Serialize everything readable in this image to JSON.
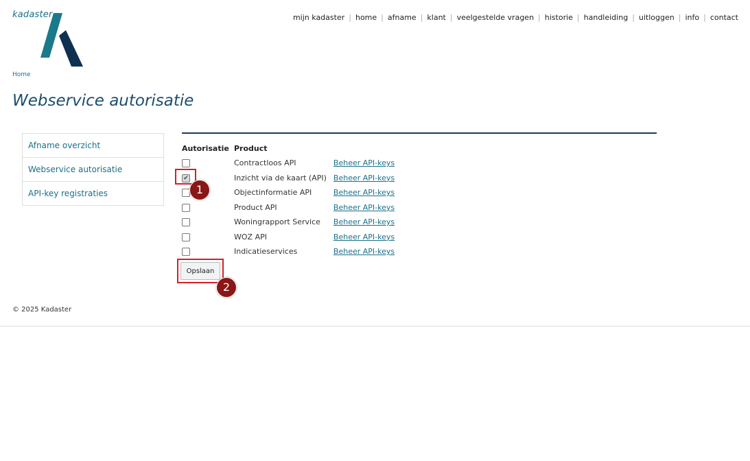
{
  "brand": {
    "logo_text": "kadaster",
    "colors": {
      "teal": "#1a7a8c",
      "navy": "#0f3050",
      "link": "#1a6f8a",
      "highlight": "#d32027",
      "badge": "#8a1616"
    }
  },
  "topnav": {
    "items": [
      "mijn kadaster",
      "home",
      "afname",
      "klant",
      "veelgestelde vragen",
      "historie",
      "handleiding",
      "uitloggen",
      "info",
      "contact"
    ]
  },
  "breadcrumb": "Home",
  "page_title": "Webservice autorisatie",
  "sidenav": {
    "items": [
      "Afname overzicht",
      "Webservice autorisatie",
      "API-key registraties"
    ]
  },
  "table": {
    "headers": {
      "auth": "Autorisatie",
      "product": "Product"
    },
    "rows": [
      {
        "checked": false,
        "product": "Contractloos API",
        "link": "Beheer API-keys"
      },
      {
        "checked": true,
        "product": "Inzicht via de kaart (API)",
        "link": "Beheer API-keys"
      },
      {
        "checked": false,
        "product": "Objectinformatie API",
        "link": "Beheer API-keys"
      },
      {
        "checked": false,
        "product": "Product API",
        "link": "Beheer API-keys"
      },
      {
        "checked": false,
        "product": "Woningrapport Service",
        "link": "Beheer API-keys"
      },
      {
        "checked": false,
        "product": "WOZ API",
        "link": "Beheer API-keys"
      },
      {
        "checked": false,
        "product": "Indicatieservices",
        "link": "Beheer API-keys"
      }
    ]
  },
  "save_label": "Opslaan",
  "annotations": {
    "badge1": "1",
    "badge2": "2"
  },
  "footer": "© 2025 Kadaster"
}
